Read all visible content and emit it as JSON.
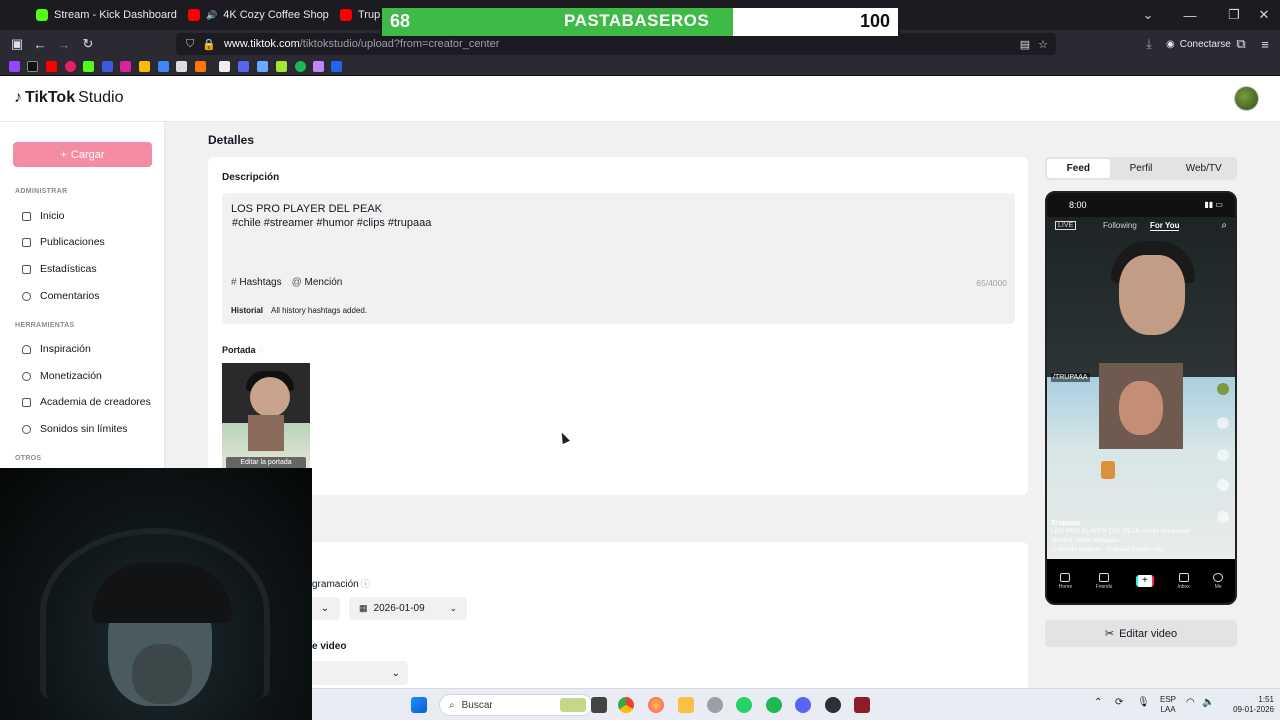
{
  "browser": {
    "tabs": [
      {
        "label": "Stream - Kick Dashboard",
        "favicon_color": "#53fc18"
      },
      {
        "label": "4K Cozy Coffee Shop with",
        "favicon_color": "#ff0000",
        "audio": true
      },
      {
        "label": "Trupaaa",
        "favicon_color": "#ff0000"
      }
    ],
    "url_host": "www.tiktok.com",
    "url_path": "/tiktokstudio/upload?from=creator_center",
    "connect_label": "Conectarse"
  },
  "overlay": {
    "left_score": "68",
    "team_name": "PASTABASEROS",
    "right_score": "100",
    "bar_color": "#3dbb46",
    "fill_percent": 68
  },
  "app": {
    "brand_name": "TikTok",
    "brand_suffix": "Studio"
  },
  "sidebar": {
    "upload_label": "Cargar",
    "sections": {
      "administrar": "ADMINISTRAR",
      "herramientas": "HERRAMIENTAS",
      "otros": "OTROS"
    },
    "admin_items": [
      "Inicio",
      "Publicaciones",
      "Estadísticas",
      "Comentarios"
    ],
    "tool_items": [
      "Inspiración",
      "Monetización",
      "Academia de creadores",
      "Sonidos sin límites"
    ]
  },
  "main": {
    "title": "Detalles",
    "description_label": "Descripción",
    "description_text": "LOS PRO PLAYER DEL PEAK",
    "description_tags": "#chile  #streamer  #humor  #clips  #trupaaa",
    "hashtags_label": "Hashtags",
    "mention_label": "Mención",
    "char_count": "65/4000",
    "history_key": "Historial",
    "history_value": "All history hashtags added.",
    "cover_label": "Portada",
    "cover_edit": "Editar la portada",
    "schedule_label": "gramación",
    "schedule_date": "2026-01-09",
    "video_label": "e video"
  },
  "preview": {
    "tabs": [
      "Feed",
      "Perfil",
      "Web/TV"
    ],
    "active_tab": "Feed",
    "phone_time": "8:00",
    "live": "LIVE",
    "following": "Following",
    "for_you": "For You",
    "channel_tag": "/TRUPAAA",
    "caption_user": "Trupaaa",
    "caption_text": "LOS PRO PLAYER DEL PEAK #chile #streamer #humor #clips #trupaaa",
    "caption_sound": "♫ sonido original - Trupaaa  Sonido orig",
    "nav": [
      "Home",
      "Friends",
      "",
      "Inbox",
      "Me"
    ],
    "edit_video_label": "Editar video"
  },
  "taskbar": {
    "search_placeholder": "Buscar",
    "lang_top": "ESP",
    "lang_bottom": "LAA",
    "time": "1:51",
    "date": "09-01-2026"
  }
}
